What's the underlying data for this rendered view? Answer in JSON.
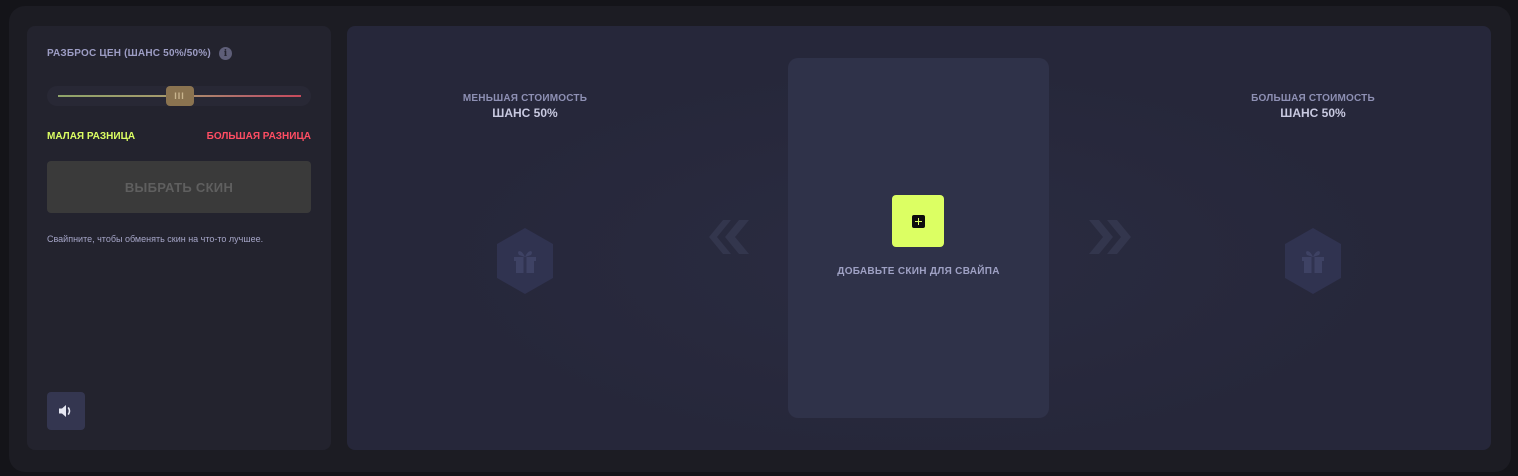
{
  "settings": {
    "spread_title": "РАЗБРОС ЦЕН (ШАНС 50%/50%)",
    "info_icon": "info-icon",
    "slider": {
      "value_fraction": 0.5,
      "thumb_label": "III"
    },
    "low_diff_label": "МАЛАЯ РАЗНИЦА",
    "high_diff_label": "БОЛЬШАЯ РАЗНИЦА",
    "choose_button": "ВЫБРАТЬ СКИН",
    "hint": "Свайпните, чтобы обменять скин на что-то лучшее.",
    "sound_icon": "speaker-icon"
  },
  "swipe": {
    "left": {
      "title": "МЕНЬШАЯ СТОИМОСТЬ",
      "chance": "ШАНС 50%",
      "icon": "gift-hex-icon"
    },
    "right": {
      "title": "БОЛЬШАЯ СТОИМОСТЬ",
      "chance": "ШАНС 50%",
      "icon": "gift-hex-icon"
    },
    "center": {
      "add_icon": "plus-icon",
      "add_text": "ДОБАВЬТЕ СКИН ДЛЯ СВАЙПА"
    },
    "left_arrows_icon": "chevrons-left-icon",
    "right_arrows_icon": "chevrons-right-icon"
  },
  "colors": {
    "accent": "#dcff63",
    "low": "#dcff63",
    "high": "#ff4d63",
    "panel": "#23232e",
    "main": "#26273a",
    "card": "#2f3249"
  }
}
